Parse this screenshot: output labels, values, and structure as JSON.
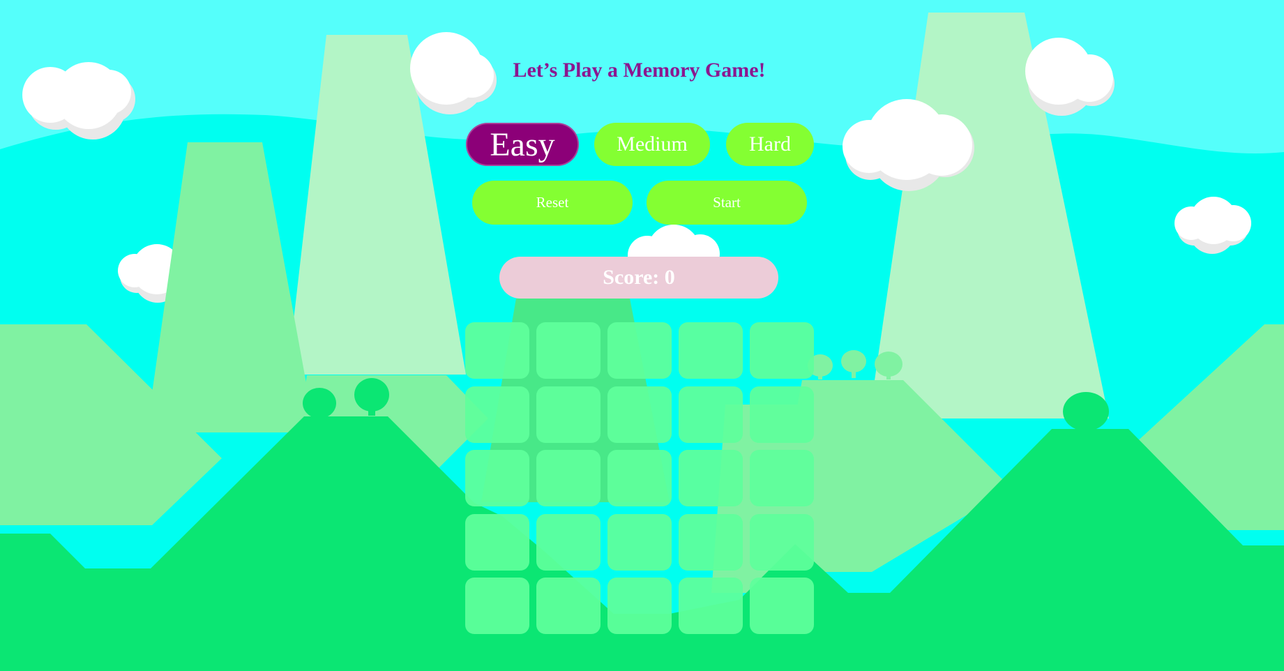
{
  "title": "Let’s Play a Memory Game!",
  "difficulty": {
    "options": [
      {
        "id": "easy",
        "label": "Easy",
        "selected": true
      },
      {
        "id": "medium",
        "label": "Medium",
        "selected": false
      },
      {
        "id": "hard",
        "label": "Hard",
        "selected": false
      }
    ]
  },
  "controls": {
    "reset_label": "Reset",
    "start_label": "Start"
  },
  "score": {
    "text": "Score: 0"
  },
  "board": {
    "rows": 5,
    "columns": 5,
    "face_down_cards": 25
  },
  "colors": {
    "sky": "#00fff0",
    "title": "#8b178f",
    "button_green": "#84ff32",
    "button_selected": "#8c0078",
    "score_panel": "#ecccd8",
    "card_back": "#5fff9b",
    "ground": "#0be673",
    "hill_light": "#80f2a2",
    "mountain_pale": "#b3f5c6"
  }
}
